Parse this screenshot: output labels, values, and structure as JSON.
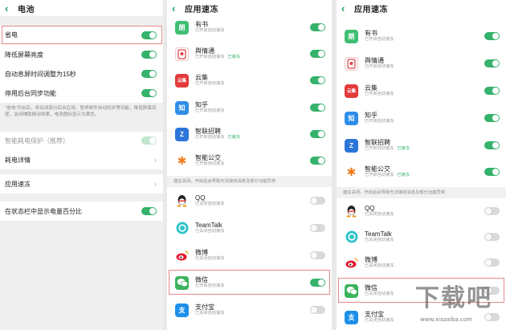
{
  "panel1": {
    "title": "电池",
    "rows": [
      {
        "label": "省电",
        "toggle": "on"
      },
      {
        "label": "降低屏幕亮度",
        "toggle": "on"
      },
      {
        "label": "自动息屏时间调整为15秒",
        "toggle": "on"
      },
      {
        "label": "停用后台同步功能",
        "toggle": "on"
      }
    ],
    "note": "\"省电\"开启后，将关闭部分后台应用，暂停邮件自动同步等功能，降低屏幕亮度，关闭辅助振动效果，电池图标显示为黄色。",
    "smart_protect": "智能耗电保护（推荐）",
    "power_detail": "耗电详情",
    "app_freeze": "应用速冻",
    "show_percent": "在状态栏中显示电量百分比"
  },
  "panel2": {
    "title": "应用速冻",
    "apps_top": [
      {
        "name": "有书",
        "sub": "已开启自动速冻",
        "status": "",
        "icon": "book-app-icon"
      },
      {
        "name": "舆情通",
        "sub": "已开启自动速冻",
        "status": "已速冻",
        "icon": "yuqing-app-icon"
      },
      {
        "name": "云集",
        "sub": "已开启自动速冻",
        "status": "",
        "icon": "yunji-app-icon"
      },
      {
        "name": "知乎",
        "sub": "已开启自动速冻",
        "status": "",
        "icon": "zhihu-app-icon"
      },
      {
        "name": "智联招聘",
        "sub": "已开启自动速冻",
        "status": "已速冻",
        "icon": "zhilian-app-icon"
      },
      {
        "name": "智能公交",
        "sub": "已开启自动速冻",
        "status": "",
        "icon": "bus-app-icon"
      }
    ],
    "suggest": "建议关闭，开启后会导致无法接收消息及部分功能异常",
    "apps_bottom": [
      {
        "name": "QQ",
        "sub": "已关闭自动速冻",
        "icon": "qq-app-icon"
      },
      {
        "name": "TeamTalk",
        "sub": "已关闭自动速冻",
        "icon": "teamtalk-app-icon"
      },
      {
        "name": "微博",
        "sub": "已关闭自动速冻",
        "icon": "weibo-app-icon"
      },
      {
        "name": "微信",
        "sub": "已开启自动速冻",
        "icon": "wechat-app-icon"
      },
      {
        "name": "支付宝",
        "sub": "已关闭自动速冻",
        "icon": "alipay-app-icon"
      }
    ]
  },
  "panel3": {
    "title": "应用速冻",
    "apps_top": [
      {
        "name": "有书",
        "sub": "已开启自动速冻",
        "status": ""
      },
      {
        "name": "舆情通",
        "sub": "已开启自动速冻",
        "status": ""
      },
      {
        "name": "云集",
        "sub": "已开启自动速冻",
        "status": ""
      },
      {
        "name": "知乎",
        "sub": "已开启自动速冻",
        "status": ""
      },
      {
        "name": "智联招聘",
        "sub": "已开启自动速冻",
        "status": "已速冻"
      },
      {
        "name": "智能公交",
        "sub": "已开启自动速冻",
        "status": "已速冻"
      }
    ],
    "suggest": "建议关闭，开启后会导致无法接收消息及部分功能异常",
    "apps_bottom": [
      {
        "name": "QQ",
        "sub": "已关闭自动速冻"
      },
      {
        "name": "TeamTalk",
        "sub": "已关闭自动速冻"
      },
      {
        "name": "微博",
        "sub": "已关闭自动速冻"
      },
      {
        "name": "微信",
        "sub": "已关闭自动速冻"
      },
      {
        "name": "支付宝",
        "sub": "已关闭自动速冻"
      }
    ]
  },
  "icon_glyphs": {
    "youshu": "朗",
    "yunji": "云集",
    "zhihu": "知",
    "zhilian": "Z",
    "alipay": "支"
  },
  "watermark": {
    "text": "下载吧",
    "url": "www.xiazaiba.com"
  },
  "colors": {
    "accent": "#35b26b",
    "highlight": "#e58a8a",
    "status_green": "#35b26b"
  }
}
